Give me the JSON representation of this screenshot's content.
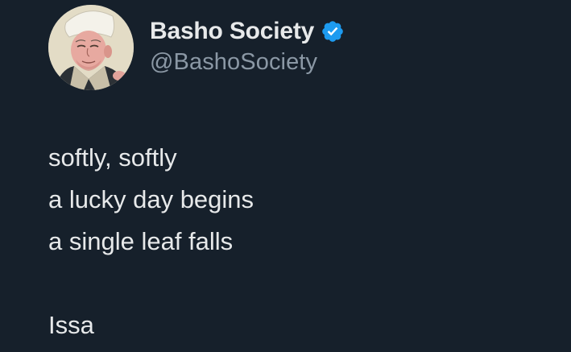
{
  "author": {
    "display_name": "Basho Society",
    "handle": "@BashoSociety",
    "verified": true,
    "verified_color": "#1d9bf0"
  },
  "tweet": {
    "lines": [
      "softly, softly",
      "a lucky day begins",
      "a single leaf falls"
    ],
    "attribution": "Issa"
  },
  "theme": {
    "background": "#16202b",
    "text": "#e7e9ea",
    "secondary_text": "#8b98a5"
  }
}
